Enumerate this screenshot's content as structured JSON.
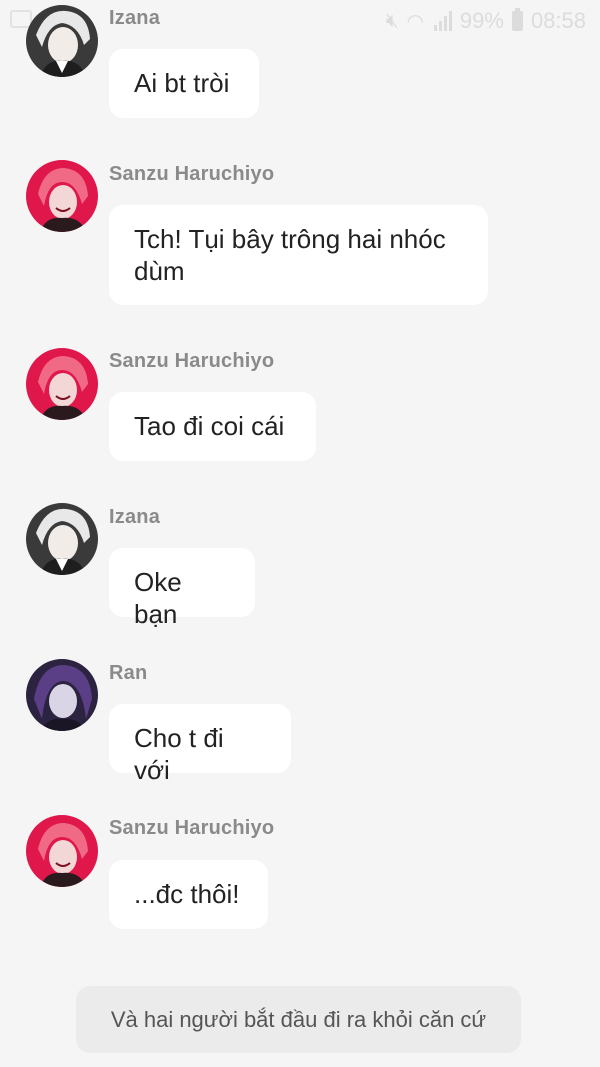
{
  "status_bar": {
    "battery": "99%",
    "time": "08:58"
  },
  "messages": [
    {
      "sender": "Izana",
      "text": "Ai bt tròi",
      "avatar": "izana-avatar"
    },
    {
      "sender": "Sanzu Haruchiyo",
      "text": "Tch! Tụi bây trông hai nhóc dùm",
      "avatar": "sanzu-avatar"
    },
    {
      "sender": "Sanzu Haruchiyo",
      "text": "Tao đi coi cái",
      "avatar": "sanzu-avatar"
    },
    {
      "sender": "Izana",
      "text": "Oke bạn",
      "avatar": "izana-avatar"
    },
    {
      "sender": "Ran",
      "text": "Cho t đi với",
      "avatar": "ran-avatar"
    },
    {
      "sender": "Sanzu Haruchiyo",
      "text": "...đc thôi!",
      "avatar": "sanzu-avatar"
    }
  ],
  "narration": "Và hai người bắt đầu đi ra khỏi căn cứ",
  "colors": {
    "background": "#f5f5f5",
    "bubble": "#ffffff",
    "sender_name": "#8a8a8a",
    "narration_bg": "#ebebeb",
    "sanzu_accent": "#e0174a",
    "ran_accent": "#2b2340"
  }
}
